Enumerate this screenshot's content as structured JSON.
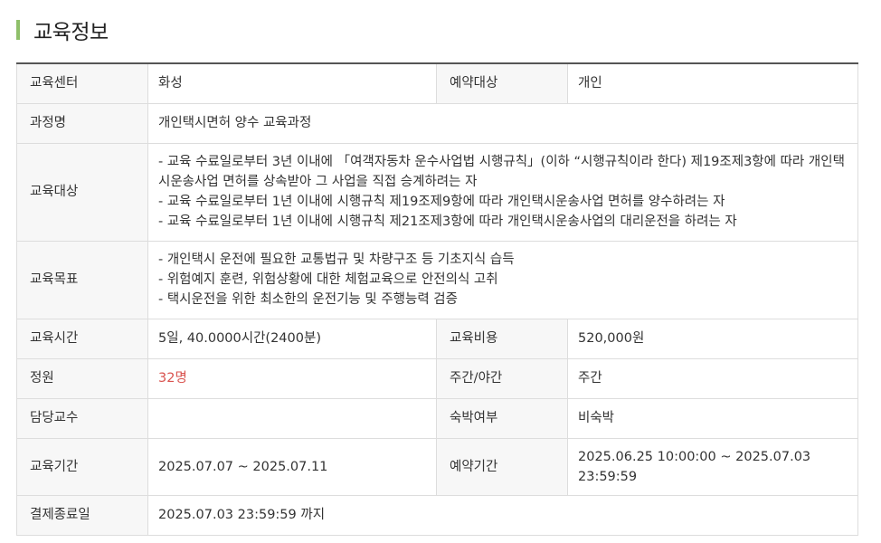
{
  "section_title": "교육정보",
  "rows": {
    "center": {
      "label": "교육센터",
      "value": "화성"
    },
    "target_group": {
      "label": "예약대상",
      "value": "개인"
    },
    "course": {
      "label": "과정명",
      "value": "개인택시면허 양수 교육과정"
    },
    "eligibility": {
      "label": "교육대상",
      "lines": [
        "- 교육 수료일로부터 3년 이내에 「여객자동차 운수사업법 시행규칙」(이하 “시행규칙이라 한다) 제19조제3항에 따라 개인택",
        "시운송사업 면허를 상속받아 그 사업을 직접 승계하려는 자",
        "- 교육 수료일로부터 1년 이내에 시행규칙 제19조제9항에 따라 개인택시운송사업 면허를 양수하려는 자",
        "- 교육 수료일로부터 1년 이내에 시행규칙 제21조제3항에 따라 개인택시운송사업의 대리운전을 하려는 자"
      ]
    },
    "goals": {
      "label": "교육목표",
      "lines": [
        "- 개인택시 운전에 필요한 교통법규 및 차량구조 등 기초지식 습득",
        "- 위험예지 훈련, 위험상황에 대한 체험교육으로 안전의식 고취",
        "- 택시운전을 위한 최소한의 운전기능 및 주행능력 검증"
      ]
    },
    "hours": {
      "label": "교육시간",
      "value": "5일, 40.0000시간(2400분)"
    },
    "fee": {
      "label": "교육비용",
      "value": "520,000원"
    },
    "capacity": {
      "label": "정원",
      "value": "32명"
    },
    "day_night": {
      "label": "주간/야간",
      "value": "주간"
    },
    "instructor": {
      "label": "담당교수",
      "value": ""
    },
    "lodging": {
      "label": "숙박여부",
      "value": "비숙박"
    },
    "period": {
      "label": "교육기간",
      "value": "2025.07.07 ~ 2025.07.11"
    },
    "booking_period": {
      "label": "예약기간",
      "line1": "2025.06.25 10:00:00 ~ 2025.07.03",
      "line2": "23:59:59"
    },
    "payment_deadline": {
      "label": "결제종료일",
      "value": "2025.07.03 23:59:59 까지"
    }
  },
  "colors": {
    "accent_bar": "#8fc06a",
    "capacity_text": "#d9534f",
    "header_bg": "#f7f7f7"
  }
}
